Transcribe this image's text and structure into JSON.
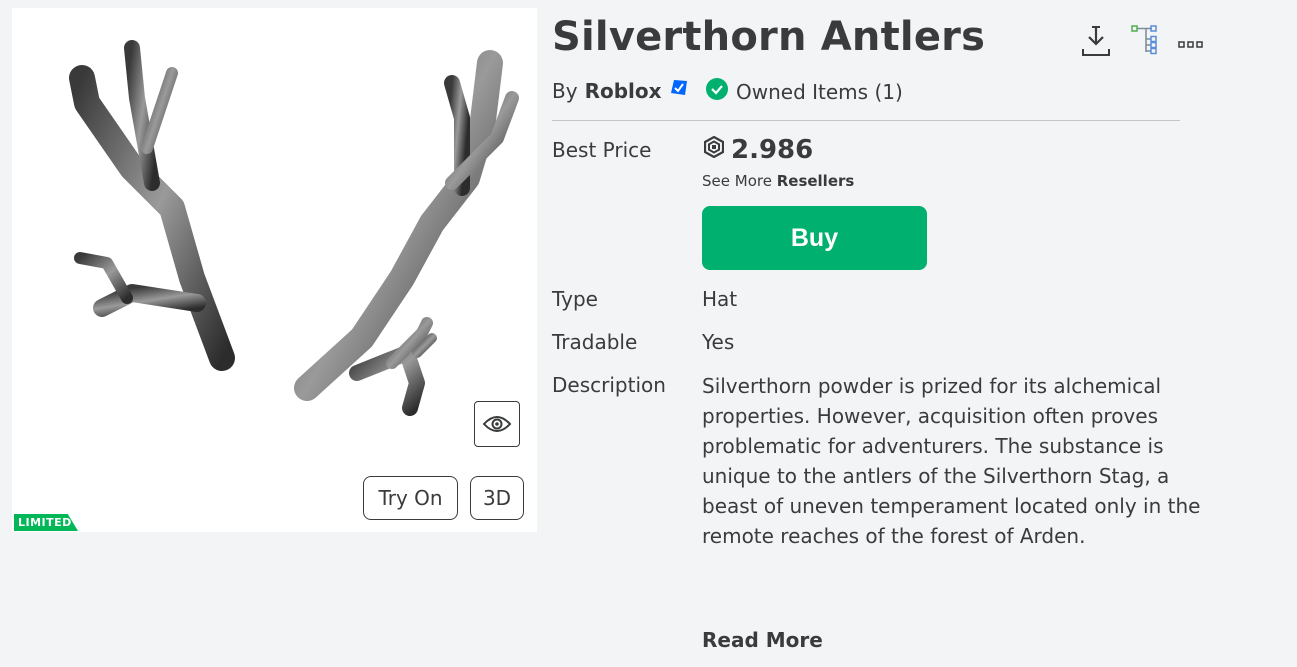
{
  "item": {
    "title": "Silverthorn Antlers",
    "by_prefix": "By",
    "creator": "Roblox",
    "owned_text": "Owned Items (1)"
  },
  "price": {
    "label": "Best Price",
    "value": "2.986",
    "see_more": "See More",
    "resellers": "Resellers"
  },
  "buy_label": "Buy",
  "details": {
    "type_label": "Type",
    "type_value": "Hat",
    "tradable_label": "Tradable",
    "tradable_value": "Yes",
    "description_label": "Description",
    "description": "Silverthorn powder is prized for its alchemical properties. However, acquisition often proves problematic for adventurers. The substance is unique to the antlers of the Silverthorn Stag, a beast of uneven temperament located only in the remote reaches of the forest of Arden.",
    "read_more": "Read More"
  },
  "preview": {
    "try_on_label": "Try On",
    "three_d_label": "3D",
    "limited_badge": "LIMITED"
  },
  "icons": {
    "download": "download-icon",
    "tree": "hierarchy-icon",
    "more": "more-icon",
    "eye": "eye-icon",
    "robux": "robux-icon",
    "verified": "verified-badge-icon",
    "owned": "check-circle-icon"
  },
  "colors": {
    "buy_green": "#00b06f",
    "limited_green": "#02b757",
    "verified_blue": "#0066ff",
    "background": "#f2f4f5"
  }
}
